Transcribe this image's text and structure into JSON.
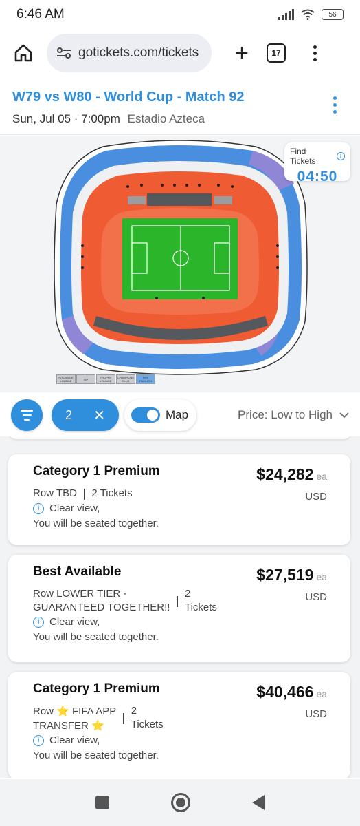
{
  "status_bar": {
    "time": "6:46 AM",
    "battery": "56"
  },
  "browser": {
    "url": "gotickets.com/tickets",
    "tab_count": "17"
  },
  "event": {
    "title": "W79 vs W80 - World Cup - Match 92",
    "datetime": "Sun, Jul 05 · 7:00pm",
    "venue": "Estadio Azteca"
  },
  "timer": {
    "label": "Find Tickets",
    "value": "04:50"
  },
  "legend": [
    "PITCHSIDE LOUNGE",
    "VIP",
    "TROPHY LOUNGE",
    "CHAMPIONS CLUB",
    "FIFA PAVILION"
  ],
  "filters": {
    "quantity": "2",
    "map_label": "Map",
    "sort_label": "Price: Low to High"
  },
  "listings": [
    {
      "title": "Category 1 Premium",
      "price": "$24,282",
      "price_unit": "ea",
      "currency": "USD",
      "row": "Row TBD",
      "tickets": "2 Tickets",
      "feature": "Clear view,",
      "note": "You will be seated together."
    },
    {
      "title": "Best Available",
      "price": "$27,519",
      "price_unit": "ea",
      "currency": "USD",
      "row_line1": "Row LOWER TIER -",
      "row_line2": "GUARANTEED TOGETHER!!",
      "tickets_line1": "2",
      "tickets_line2": "Tickets",
      "feature": "Clear view,",
      "note": "You will be seated together."
    },
    {
      "title": "Category 1 Premium",
      "price": "$40,466",
      "price_unit": "ea",
      "currency": "USD",
      "row_line1": "Row ⭐ FIFA APP",
      "row_line2": "TRANSFER ⭐",
      "tickets_line1": "2",
      "tickets_line2": "Tickets",
      "feature": "Clear view,",
      "note": "You will be seated together."
    }
  ]
}
